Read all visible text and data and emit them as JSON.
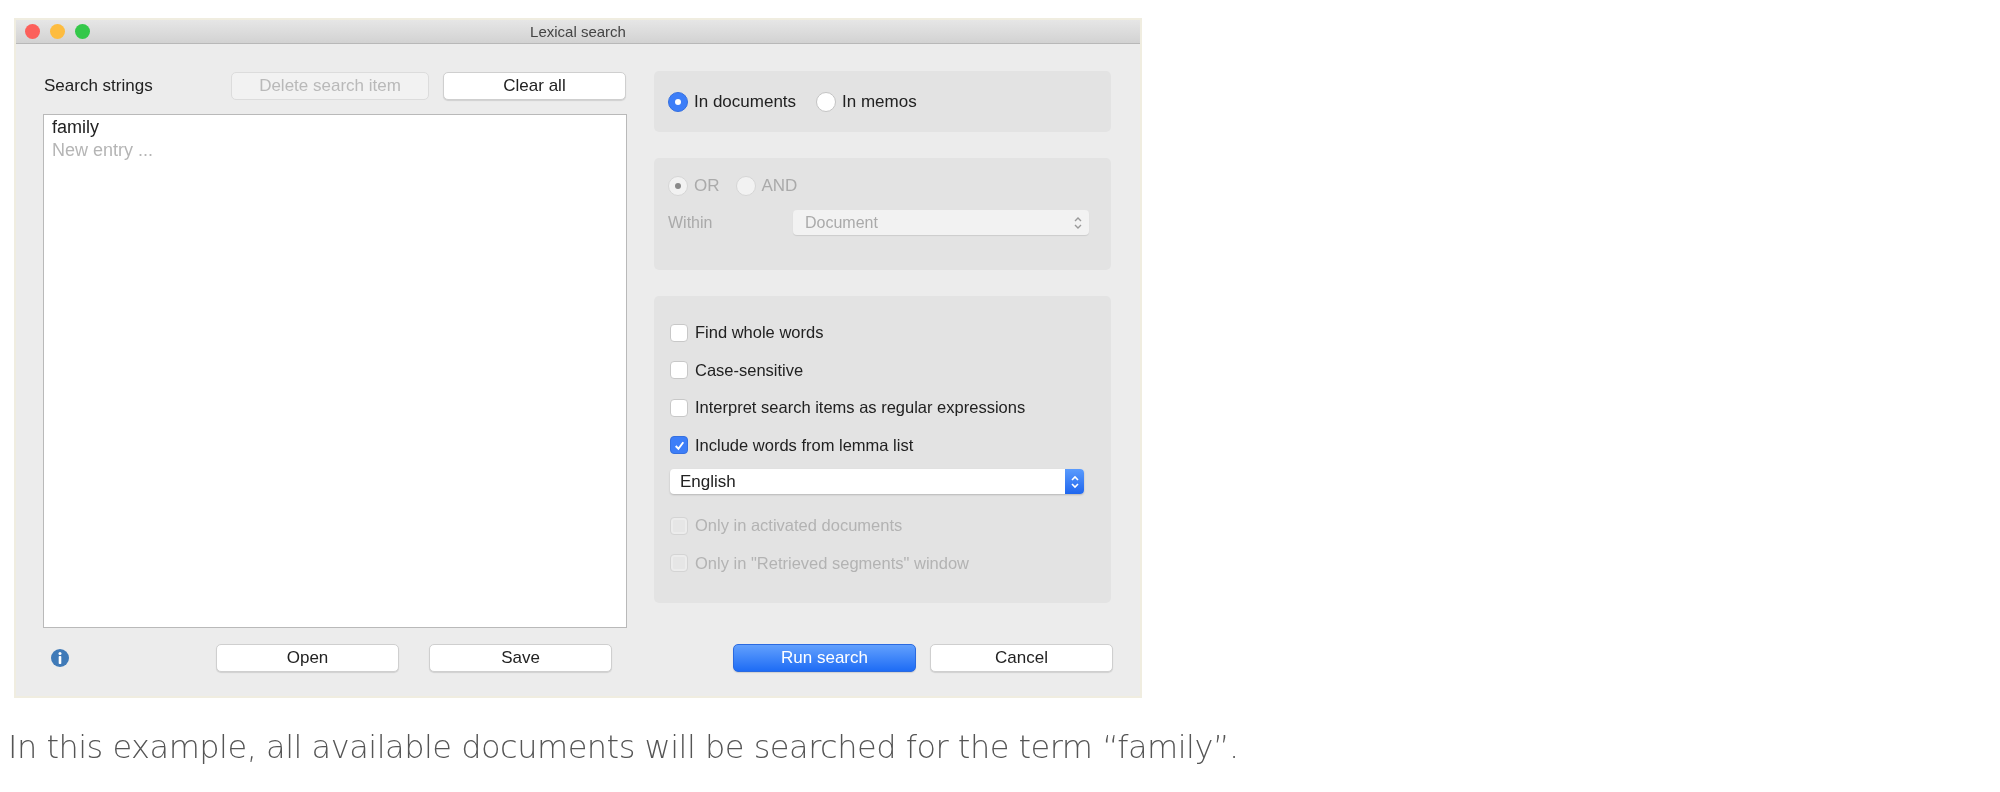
{
  "window": {
    "title": "Lexical search"
  },
  "search_strings": {
    "label": "Search strings",
    "buttons": [
      {
        "label": "Delete search item",
        "disabled": true
      },
      {
        "label": "Clear all",
        "disabled": false
      }
    ],
    "entries": [
      "family"
    ],
    "new_entry_placeholder": "New entry ..."
  },
  "scope": {
    "radios": [
      {
        "label": "In documents",
        "selected": true
      },
      {
        "label": "In memos",
        "selected": false
      }
    ]
  },
  "logic": {
    "disabled": true,
    "radios": [
      {
        "label": "OR",
        "selected": true
      },
      {
        "label": "AND",
        "selected": false
      }
    ],
    "within_label": "Within",
    "within_value": "Document"
  },
  "options": [
    {
      "kind": "checkbox",
      "label": "Find whole words",
      "checked": false,
      "disabled": false
    },
    {
      "kind": "checkbox",
      "label": "Case-sensitive",
      "checked": false,
      "disabled": false
    },
    {
      "kind": "checkbox",
      "label": "Interpret search items as regular expressions",
      "checked": false,
      "disabled": false
    },
    {
      "kind": "checkbox",
      "label": "Include words from lemma list",
      "checked": true,
      "disabled": false
    },
    {
      "kind": "dropdown",
      "value": "English",
      "disabled": false
    },
    {
      "kind": "checkbox",
      "label": "Only in activated documents",
      "checked": false,
      "disabled": true
    },
    {
      "kind": "checkbox",
      "label": "Only in \"Retrieved segments\" window",
      "checked": false,
      "disabled": true
    }
  ],
  "file_buttons": [
    {
      "label": "Open"
    },
    {
      "label": "Save"
    }
  ],
  "action_buttons": [
    {
      "label": "Run search",
      "primary": true
    },
    {
      "label": "Cancel",
      "primary": false
    }
  ],
  "caption": "In this example, all available documents will be searched for the term “family”."
}
